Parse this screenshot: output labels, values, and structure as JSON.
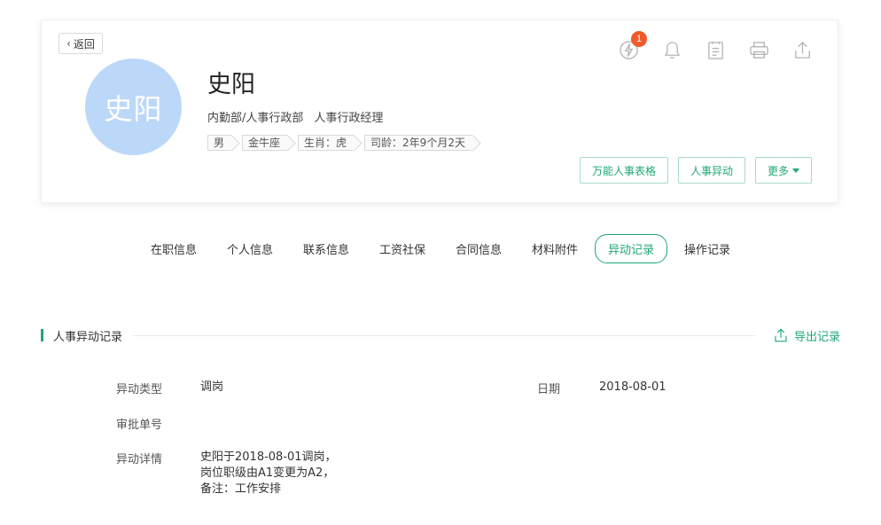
{
  "header": {
    "back_label": "返回",
    "avatar_text": "史阳",
    "name": "史阳",
    "department": "内勤部/人事行政部",
    "position": "人事行政经理",
    "tags": [
      "男",
      "金牛座",
      "生肖：虎",
      "司龄：2年9个月2天"
    ],
    "notification_badge": "1",
    "icons": [
      "flash-icon",
      "bell-icon",
      "notes-icon",
      "printer-icon",
      "share-icon"
    ],
    "buttons": {
      "hr_table": "万能人事表格",
      "hr_change": "人事异动",
      "more": "更多"
    }
  },
  "tabs": [
    {
      "label": "在职信息",
      "active": false
    },
    {
      "label": "个人信息",
      "active": false
    },
    {
      "label": "联系信息",
      "active": false
    },
    {
      "label": "工资社保",
      "active": false
    },
    {
      "label": "合同信息",
      "active": false
    },
    {
      "label": "材料附件",
      "active": false
    },
    {
      "label": "异动记录",
      "active": true
    },
    {
      "label": "操作记录",
      "active": false
    }
  ],
  "section": {
    "title": "人事异动记录",
    "export_label": "导出记录"
  },
  "record": {
    "type_label": "异动类型",
    "type_value": "调岗",
    "date_label": "日期",
    "date_value": "2018-08-01",
    "approval_label": "审批单号",
    "approval_value": "",
    "detail_label": "异动详情",
    "detail_lines": [
      "史阳于2018-08-01调岗，",
      "岗位职级由A1变更为A2，",
      "备注：工作安排"
    ]
  },
  "colors": {
    "accent": "#1fa872",
    "avatar_bg": "#bcd8f8",
    "badge": "#f05a2b"
  }
}
